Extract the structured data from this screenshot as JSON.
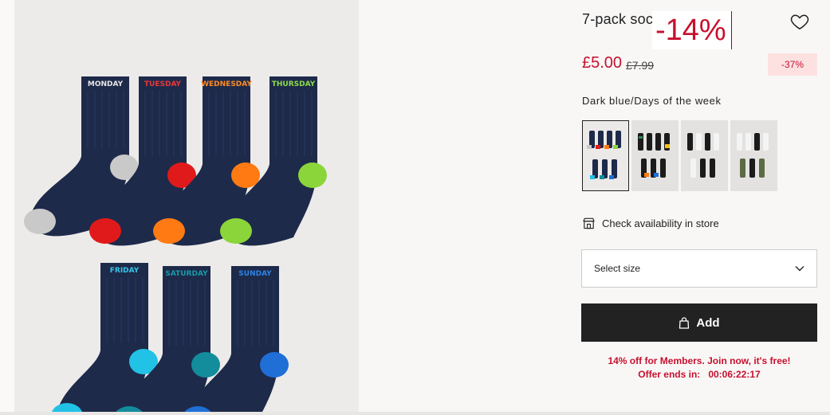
{
  "product": {
    "title": "7-pack socks",
    "promo_overlay": "-14%",
    "price_now": "£5.00",
    "price_old": "£7.99",
    "discount": "-37%",
    "color_name": "Dark blue/Days of the week"
  },
  "image": {
    "sock_labels": [
      "MONDAY",
      "TUESDAY",
      "WEDNESDAY",
      "THURSDAY",
      "FRIDAY",
      "SATURDAY",
      "SUNDAY"
    ],
    "sock_colors": [
      "#c9c9c9",
      "#e01a1a",
      "#ff7a12",
      "#8bd53a",
      "#22c1e6",
      "#138c9b",
      "#1f6fd6"
    ],
    "label_colors": [
      "#e6e6e6",
      "#e53a3a",
      "#ff8a22",
      "#8ddc4a",
      "#36c6e8",
      "#179aa8",
      "#2d83e3"
    ],
    "sock_body_color": "#1e2a4a"
  },
  "swatches": [
    {
      "name": "Dark blue/Days of the week",
      "selected": true
    },
    {
      "name": "Black/Multicolour",
      "selected": false
    },
    {
      "name": "Black/White",
      "selected": false
    },
    {
      "name": "White/Khaki",
      "selected": false
    }
  ],
  "store": {
    "label": "Check availability in store"
  },
  "size": {
    "label": "Select size"
  },
  "cart": {
    "add_label": "Add"
  },
  "member": {
    "line1": "14% off for Members. Join now, it's free!",
    "offer_label": "Offer ends in:",
    "countdown": "00:06:22:17"
  }
}
